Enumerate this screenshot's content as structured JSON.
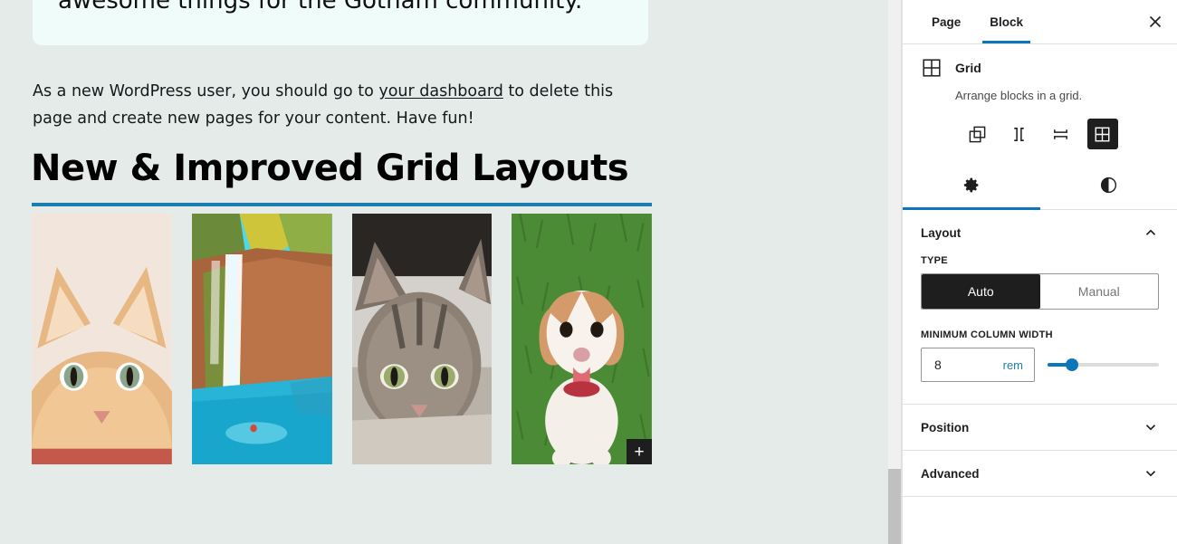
{
  "canvas": {
    "intro_card_text": "awesome things for the Gotham community.",
    "paragraph_before": "As a new WordPress user, you should go to ",
    "paragraph_link": "your dashboard",
    "paragraph_after": " to delete this page and create new pages for your content. Have fun!",
    "heading": "New & Improved Grid Layouts",
    "accent_color": "#1a7fb0",
    "background_color": "#e4ebe8",
    "card_color": "#f0fcfa",
    "appender_label": "+",
    "images": [
      {
        "alt": "orange tabby cat close-up",
        "name": "grid-image-cat-orange"
      },
      {
        "alt": "waterfall over red rock cliff",
        "name": "grid-image-waterfall"
      },
      {
        "alt": "grey tabby cat lying down",
        "name": "grid-image-cat-tabby"
      },
      {
        "alt": "beagle puppy sitting on grass",
        "name": "grid-image-dog"
      }
    ]
  },
  "sidebar": {
    "tabs": [
      {
        "label": "Page",
        "active": false
      },
      {
        "label": "Block",
        "active": true
      }
    ],
    "close_icon": "close-icon",
    "block": {
      "icon": "grid-icon",
      "title": "Grid",
      "description": "Arrange blocks in a grid.",
      "variations": [
        {
          "name": "stack-variation",
          "icon": "stack-icon",
          "selected": false
        },
        {
          "name": "row-variation",
          "icon": "row-icon",
          "selected": false
        },
        {
          "name": "column-variation",
          "icon": "column-icon",
          "selected": false
        },
        {
          "name": "grid-variation",
          "icon": "grid-icon",
          "selected": true
        }
      ]
    },
    "icon_tabs": [
      {
        "name": "settings-tab",
        "icon": "gear-icon",
        "active": true
      },
      {
        "name": "styles-tab",
        "icon": "contrast-icon",
        "active": false
      }
    ],
    "panels": [
      {
        "title": "Layout",
        "expanded": true
      },
      {
        "title": "Position",
        "expanded": false
      },
      {
        "title": "Advanced",
        "expanded": false
      }
    ],
    "layout": {
      "type_label": "TYPE",
      "type_options": [
        {
          "label": "Auto",
          "selected": true
        },
        {
          "label": "Manual",
          "selected": false
        }
      ],
      "min_column_width_label": "MINIMUM COLUMN WIDTH",
      "min_column_width_value": "8",
      "min_column_width_unit": "rem",
      "slider_percent": 22
    }
  }
}
